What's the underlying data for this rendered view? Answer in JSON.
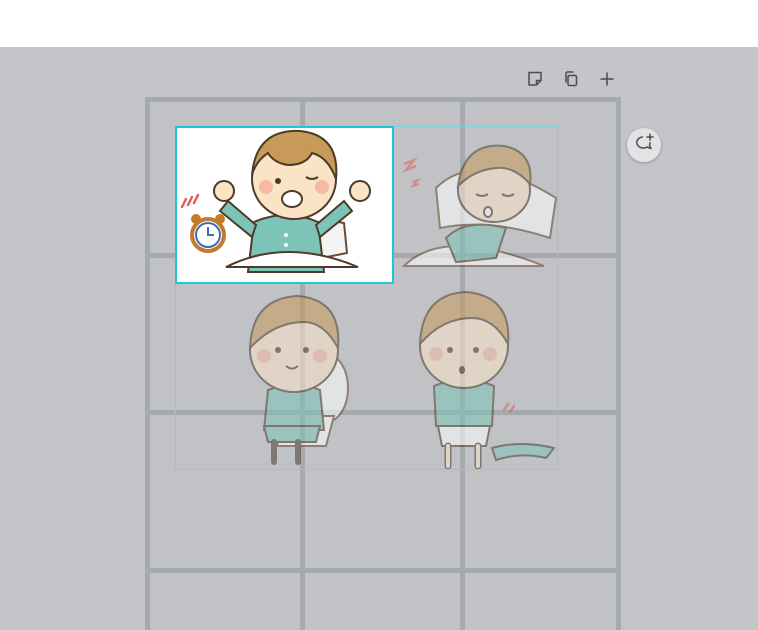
{
  "editor": {
    "toolbar": {
      "note_icon": "sticky-note-icon",
      "duplicate_icon": "duplicate-icon",
      "add_icon": "plus-icon"
    },
    "comment_icon": "add-comment-icon",
    "colors": {
      "canvas_bg": "#c3c5c8",
      "selection": "#1fc6d6",
      "group_outline": "#7fd0d7",
      "grid_lines": "#a6a9ae",
      "pajama": "#7cc4b8",
      "hair": "#c89a5a"
    }
  },
  "stickers": [
    {
      "name": "waking-boy",
      "selected": true
    },
    {
      "name": "sleeping-boy",
      "selected": false
    },
    {
      "name": "toilet-boy",
      "selected": false
    },
    {
      "name": "changing-boy",
      "selected": false
    }
  ]
}
